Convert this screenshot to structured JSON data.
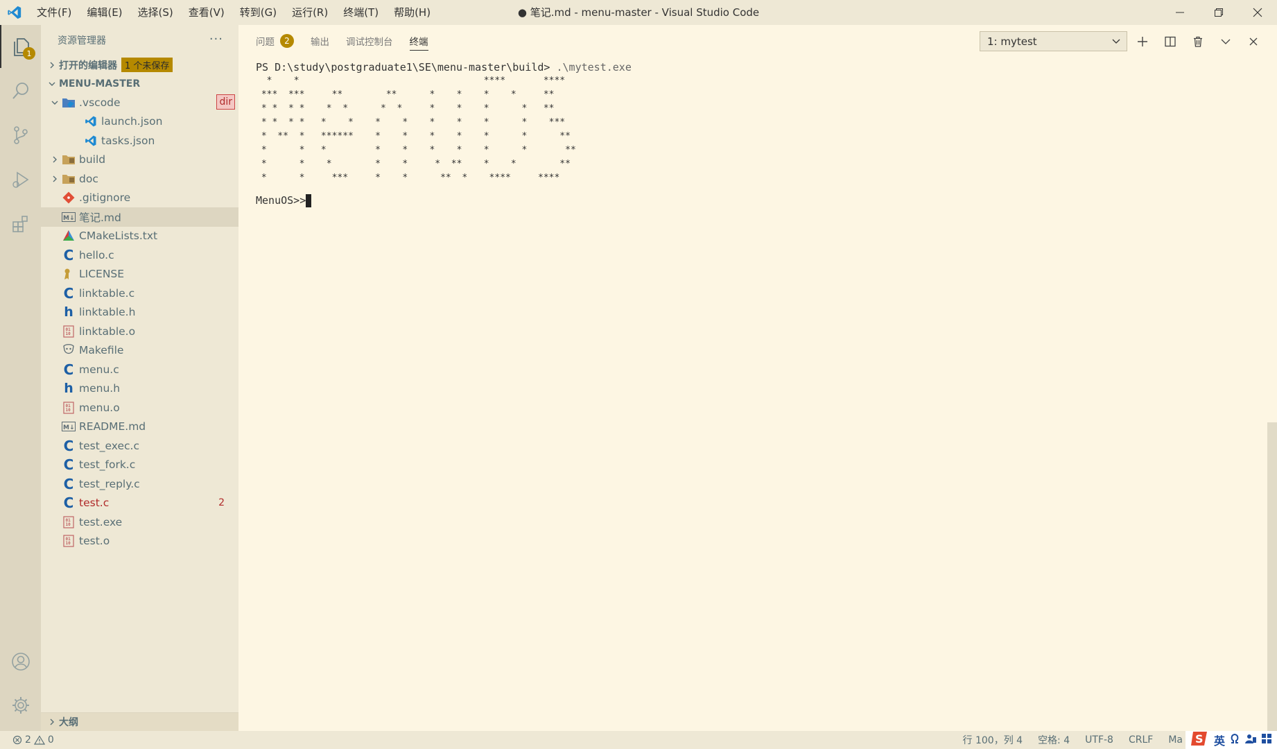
{
  "titlebar": {
    "menus": [
      "文件(F)",
      "编辑(E)",
      "选择(S)",
      "查看(V)",
      "转到(G)",
      "运行(R)",
      "终端(T)",
      "帮助(H)"
    ],
    "title": "● 笔记.md - menu-master - Visual Studio Code"
  },
  "activitybar": {
    "explorer_badge": "1"
  },
  "sidebar": {
    "header": "资源管理器",
    "more": "···",
    "open_editors": "打开的编辑器",
    "unsaved_badge": "1 个未保存",
    "project": "MENU-MASTER",
    "items": [
      {
        "name": ".vscode",
        "type": "folder-open",
        "level": 1,
        "icon": "vscode-folder-icon",
        "badge": "dir"
      },
      {
        "name": "launch.json",
        "type": "file",
        "level": 2,
        "icon": "vscode-json-icon"
      },
      {
        "name": "tasks.json",
        "type": "file",
        "level": 2,
        "icon": "vscode-json-icon"
      },
      {
        "name": "build",
        "type": "folder",
        "level": 1,
        "icon": "folder-icon"
      },
      {
        "name": "doc",
        "type": "folder",
        "level": 1,
        "icon": "folder-icon"
      },
      {
        "name": ".gitignore",
        "type": "file",
        "level": 1,
        "icon": "git-icon"
      },
      {
        "name": "笔记.md",
        "type": "file",
        "level": 1,
        "icon": "markdown-icon",
        "selected": true
      },
      {
        "name": "CMakeLists.txt",
        "type": "file",
        "level": 1,
        "icon": "cmake-icon"
      },
      {
        "name": "hello.c",
        "type": "file",
        "level": 1,
        "icon": "c-icon"
      },
      {
        "name": "LICENSE",
        "type": "file",
        "level": 1,
        "icon": "license-icon"
      },
      {
        "name": "linktable.c",
        "type": "file",
        "level": 1,
        "icon": "c-icon"
      },
      {
        "name": "linktable.h",
        "type": "file",
        "level": 1,
        "icon": "h-icon"
      },
      {
        "name": "linktable.o",
        "type": "file",
        "level": 1,
        "icon": "binary-icon"
      },
      {
        "name": "Makefile",
        "type": "file",
        "level": 1,
        "icon": "makefile-icon"
      },
      {
        "name": "menu.c",
        "type": "file",
        "level": 1,
        "icon": "c-icon"
      },
      {
        "name": "menu.h",
        "type": "file",
        "level": 1,
        "icon": "h-icon"
      },
      {
        "name": "menu.o",
        "type": "file",
        "level": 1,
        "icon": "binary-icon"
      },
      {
        "name": "README.md",
        "type": "file",
        "level": 1,
        "icon": "markdown-icon"
      },
      {
        "name": "test_exec.c",
        "type": "file",
        "level": 1,
        "icon": "c-icon"
      },
      {
        "name": "test_fork.c",
        "type": "file",
        "level": 1,
        "icon": "c-icon"
      },
      {
        "name": "test_reply.c",
        "type": "file",
        "level": 1,
        "icon": "c-icon"
      },
      {
        "name": "test.c",
        "type": "file",
        "level": 1,
        "icon": "c-icon",
        "error": true,
        "count": "2"
      },
      {
        "name": "test.exe",
        "type": "file",
        "level": 1,
        "icon": "binary-icon"
      },
      {
        "name": "test.o",
        "type": "file",
        "level": 1,
        "icon": "binary-icon"
      }
    ],
    "outline": "大纲"
  },
  "panel": {
    "tabs": [
      {
        "label": "问题",
        "count": "2"
      },
      {
        "label": "输出"
      },
      {
        "label": "调试控制台"
      },
      {
        "label": "终端",
        "active": true
      }
    ],
    "terminal_select": "1: mytest",
    "terminal": {
      "prompt_path": "PS D:\\study\\postgraduate1\\SE\\menu-master\\build>",
      "command": ".\\mytest.exe",
      "ascii_art": "  *    *                                  ****       ****\n ***  ***     **        **      *    *    *    *     **\n * *  * *    *  *      *  *     *    *    *      *   **\n * *  * *   *    *    *    *    *    *    *      *    ***\n *  **  *   ******    *    *    *    *    *      *      **\n *      *   *         *    *    *    *    *      *       **\n *      *    *        *    *     *  **    *    *        **\n *      *     ***     *    *      **  *    ****     ****",
      "menu_prompt": "MenuOS>>"
    }
  },
  "statusbar": {
    "errors": "2",
    "warnings": "0",
    "position": "行 100，列 4",
    "spaces": "空格: 4",
    "encoding": "UTF-8",
    "eol": "CRLF",
    "lang": "Ma",
    "ime_labels": [
      "英"
    ]
  },
  "colors": {
    "background": "#fdf6e3",
    "sidebar": "#eee8d5",
    "activitybar": "#ddd6c1",
    "accent": "#b58900",
    "error": "#b02a2a"
  }
}
